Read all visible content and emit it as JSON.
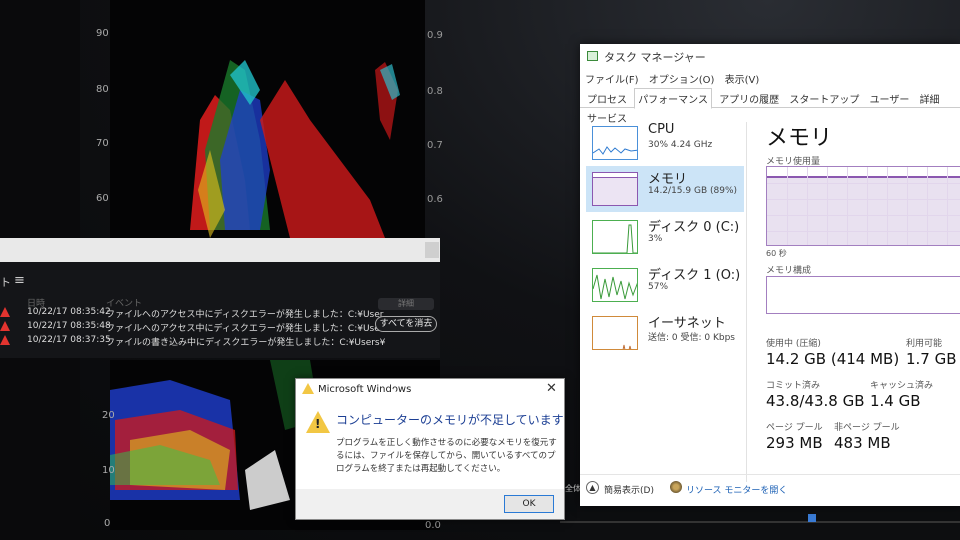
{
  "scope": {
    "top_left_ticks": [
      "90",
      "80",
      "70",
      "60"
    ],
    "top_right_ticks": [
      "0.9",
      "0.8",
      "0.7",
      "0.6"
    ],
    "bottom_left_ticks": [
      "20",
      "10",
      "0"
    ],
    "bottom_right_tick": "0.0"
  },
  "event_log": {
    "menu_glyph": "≡",
    "header_char": "ト",
    "col_date": "日時",
    "col_event": "イベント",
    "details_label": "詳細",
    "clear_all_label": "すべてを消去",
    "rows": [
      {
        "time": "10/22/17 08:35:42",
        "message": "ファイルへのアクセス中にディスクエラーが発生しました：C:¥User"
      },
      {
        "time": "10/22/17 08:35:48",
        "message": "ファイルへのアクセス中にディスクエラーが発生しました：C:¥User"
      },
      {
        "time": "10/22/17 08:37:35",
        "message": "ファイルの書き込み中にディスクエラーが発生しました：C:¥Users¥"
      }
    ]
  },
  "task_manager": {
    "title": "タスク マネージャー",
    "menu": [
      "ファイル(F)",
      "オプション(O)",
      "表示(V)"
    ],
    "tabs": [
      "プロセス",
      "パフォーマンス",
      "アプリの履歴",
      "スタートアップ",
      "ユーザー",
      "詳細",
      "サービス"
    ],
    "active_tab": "パフォーマンス",
    "resources": [
      {
        "name": "CPU",
        "sub": "30%  4.24 GHz",
        "selected": false
      },
      {
        "name": "メモリ",
        "sub": "14.2/15.9 GB (89%)",
        "selected": true
      },
      {
        "name": "ディスク 0 (C:)",
        "sub": "3%",
        "selected": false
      },
      {
        "name": "ディスク 1 (O:)",
        "sub": "57%",
        "selected": false
      },
      {
        "name": "イーサネット",
        "sub": "送信: 0  受信: 0 Kbps",
        "selected": false
      }
    ],
    "memory": {
      "title": "メモリ",
      "usage_label": "メモリ使用量",
      "graph_time_label": "60 秒",
      "usage_fraction": 0.89,
      "composition_label": "メモリ構成",
      "in_use_label": "使用中 (圧縮)",
      "in_use_value": "14.2 GB (414 MB)",
      "available_label": "利用可能",
      "available_value": "1.7 GB",
      "committed_label": "コミット済み",
      "committed_value": "43.8/43.8 GB",
      "cached_label": "キャッシュ済み",
      "cached_value": "1.4 GB",
      "paged_pool_label": "ページ プール",
      "paged_pool_value": "293 MB",
      "nonpaged_pool_label": "非ページ プール",
      "nonpaged_pool_value": "483 MB"
    },
    "footer": {
      "fewer_details": "簡易表示(D)",
      "resource_monitor": "リソース モニターを開く"
    },
    "accent_color": "#8b58b0"
  },
  "dialog": {
    "title": "Microsoft Windows",
    "close_glyph": "✕",
    "heading": "コンピューターのメモリが不足しています",
    "body": "プログラムを正しく動作させるのに必要なメモリを復元するには、ファイルを保存してから、開いているすべてのプログラムを終了または再起動してください。",
    "ok_label": "OK",
    "warn_mark": "!"
  },
  "side_text": "全体"
}
